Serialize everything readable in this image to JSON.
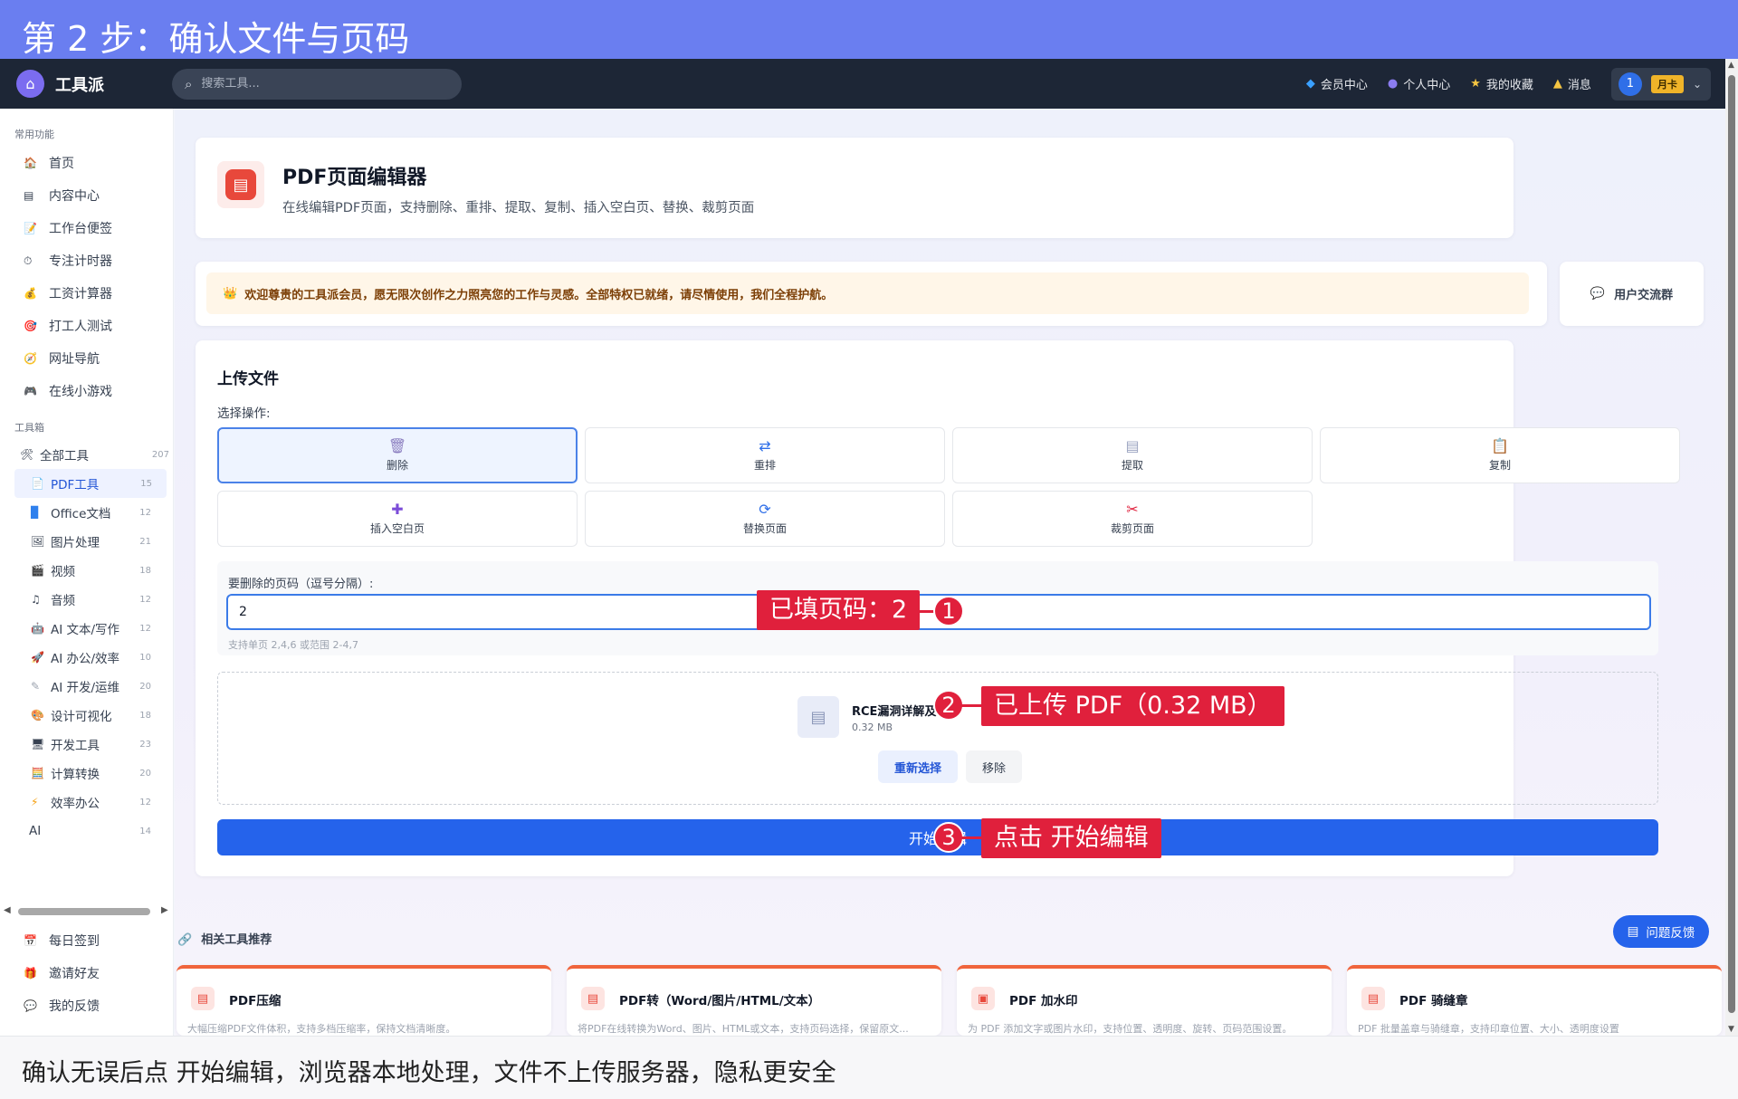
{
  "banner": {
    "step": "第 2 步：确认文件与页码",
    "bottom": "确认无误后点 开始编辑，浏览器本地处理，文件不上传服务器，隐私更安全"
  },
  "topnav": {
    "brand": "工具派",
    "search_placeholder": "搜索工具...",
    "items": [
      "会员中心",
      "个人中心",
      "我的收藏",
      "消息"
    ],
    "avatar_text": "1",
    "badge": "月卡"
  },
  "sidebar": {
    "common_title": "常用功能",
    "common": [
      "首页",
      "内容中心",
      "工作台便签",
      "专注计时器",
      "工资计算器",
      "打工人测试",
      "网址导航",
      "在线小游戏"
    ],
    "tools_title": "工具箱",
    "all_tools": {
      "label": "全部工具",
      "count": "207"
    },
    "tools": [
      {
        "label": "PDF工具",
        "count": "15"
      },
      {
        "label": "Office文档",
        "count": "12"
      },
      {
        "label": "图片处理",
        "count": "21"
      },
      {
        "label": "视频",
        "count": "18"
      },
      {
        "label": "音频",
        "count": "12"
      },
      {
        "label": "AI 文本/写作",
        "count": "12"
      },
      {
        "label": "AI 办公/效率",
        "count": "10"
      },
      {
        "label": "AI 开发/运维",
        "count": "20"
      },
      {
        "label": "设计可视化",
        "count": "18"
      },
      {
        "label": "开发工具",
        "count": "23"
      },
      {
        "label": "计算转换",
        "count": "20"
      },
      {
        "label": "效率办公",
        "count": "12"
      },
      {
        "label": "AI",
        "count": "14"
      }
    ],
    "bottom": [
      "每日签到",
      "邀请好友",
      "我的反馈"
    ]
  },
  "header": {
    "title": "PDF页面编辑器",
    "subtitle": "在线编辑PDF页面，支持删除、重排、提取、复制、插入空白页、替换、裁剪页面"
  },
  "notice": {
    "text": "欢迎尊贵的工具派会员，愿无限次创作之力照亮您的工作与灵感。全部特权已就绪，请尽情使用，我们全程护航。",
    "group": "用户交流群"
  },
  "upload": {
    "title": "上传文件",
    "op_label": "选择操作:",
    "ops": [
      "删除",
      "重排",
      "提取",
      "复制",
      "插入空白页",
      "替换页面",
      "裁剪页面"
    ],
    "pages_label": "要删除的页码（逗号分隔）:",
    "pages_value": "2",
    "pages_hint": "支持单页 2,4,6 或范围 2-4,7",
    "file_name": "RCE漏洞详解及",
    "file_size": "0.32 MB",
    "reselect": "重新选择",
    "remove": "移除",
    "start": "开始编辑"
  },
  "annotations": {
    "a1": "已填页码：2",
    "a2": "已上传 PDF（0.32 MB）",
    "a3": "点击 开始编辑",
    "n1": "1",
    "n2": "2",
    "n3": "3"
  },
  "related": {
    "title": "相关工具推荐",
    "cards": [
      {
        "name": "PDF压缩",
        "desc": "大幅压缩PDF文件体积，支持多档压缩率，保持文档清晰度。"
      },
      {
        "name": "PDF转（Word/图片/HTML/文本）",
        "desc": "将PDF在线转换为Word、图片、HTML或文本，支持页码选择，保留原文..."
      },
      {
        "name": "PDF 加水印",
        "desc": "为 PDF 添加文字或图片水印，支持位置、透明度、旋转、页码范围设置。"
      },
      {
        "name": "PDF 骑缝章",
        "desc": "PDF 批量盖章与骑缝章，支持印章位置、大小、透明度设置"
      }
    ]
  },
  "feedback": "问题反馈",
  "colors": {
    "accent": "#2563eb",
    "annotation": "#e0203c",
    "banner": "#6a7ef0"
  }
}
